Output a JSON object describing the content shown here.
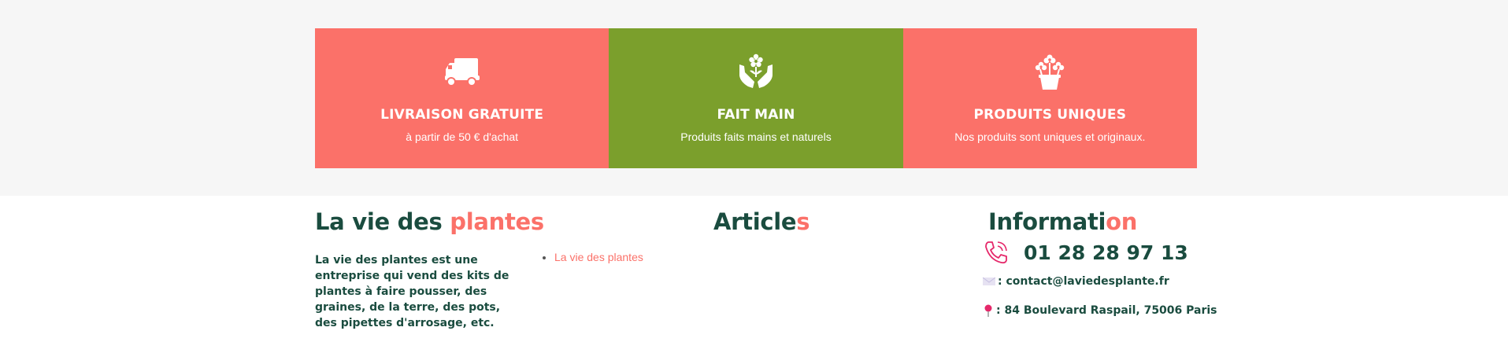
{
  "features": [
    {
      "title": "LIVRAISON GRATUITE",
      "subtitle": "à partir de 50 € d'achat",
      "icon": "truck-icon",
      "color": "#fb7169"
    },
    {
      "title": "FAIT MAIN",
      "subtitle": "Produits faits mains et naturels",
      "icon": "hands-flower-icon",
      "color": "#7b9f2c"
    },
    {
      "title": "PRODUITS UNIQUES",
      "subtitle": "Nos produits sont uniques et originaux.",
      "icon": "flower-pot-icon",
      "color": "#fb7169"
    }
  ],
  "footer": {
    "about": {
      "title_main": "La vie des ",
      "title_accent": "plantes",
      "text": "La vie des plantes est une entreprise qui vend des kits de plantes à faire pousser, des graines, de la terre, des pots, des pipettes d'arrosage, etc."
    },
    "links": [
      {
        "label": "La vie des plantes"
      }
    ],
    "articles": {
      "title_main": "Article",
      "title_accent": "s"
    },
    "information": {
      "title_main": "Informati",
      "title_accent": "on",
      "phone": "01 28 28 97 13",
      "email": ": contact@laviedesplante.fr",
      "address": ": 84 Boulevard Raspail, 75006 Paris"
    }
  },
  "colors": {
    "accent": "#fb7169",
    "green": "#7b9f2c",
    "dark_green": "#1a4c3f",
    "band_bg": "#f6f6f6"
  }
}
